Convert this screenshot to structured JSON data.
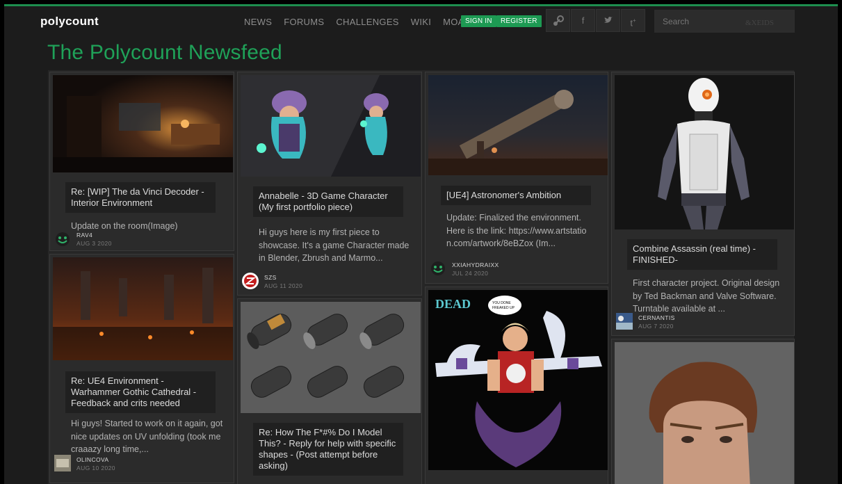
{
  "header": {
    "logo": "polycount",
    "nav": [
      "NEWS",
      "FORUMS",
      "CHALLENGES",
      "WIKI",
      "MOAR"
    ],
    "sign_in": "SIGN IN",
    "register": "REGISTER",
    "social_icons": [
      "steam-icon",
      "facebook-icon",
      "twitter-icon",
      "tumblr-icon"
    ],
    "search_placeholder": "Search",
    "search_watermark": "&XEIDS",
    "accent_color": "#1d9a53"
  },
  "page_title": "The Polycount Newsfeed",
  "posts": [
    {
      "title": "Re: [WIP] The da Vinci Decoder - Interior Environment",
      "excerpt": "Update on the room(Image)",
      "author": "RAV4",
      "date": "AUG 3 2020"
    },
    {
      "title": "Re: UE4 Environment - Warhammer Gothic Cathedral - Feedback and crits needed",
      "excerpt": "Hi guys! Started to work on it again, got nice updates on UV unfolding (took me craaazy long time,...",
      "author": "OLINCOVA",
      "date": "AUG 10 2020"
    },
    {
      "title": "Annabelle - 3D Game Character (My first portfolio piece)",
      "excerpt": "Hi guys here is my first piece to showcase. It's a game Character made in Blender, Zbrush and Marmo...",
      "author": "SZS",
      "date": "AUG 11 2020"
    },
    {
      "title": "Re: How The F*#% Do I Model This? - Reply for help with specific shapes - (Post attempt before asking)",
      "excerpt": "",
      "author": "",
      "date": ""
    },
    {
      "title": "[UE4] Astronomer's Ambition",
      "excerpt": "Update: Finalized the environment. Here is the link: https://www.artstation.com/artwork/8eBZox (Im...",
      "author": "XXIAHYDRAIXX",
      "date": "JUL 24 2020"
    },
    {
      "title": "Combine Assassin (real time) - FINISHED-",
      "excerpt": "First character project. Original design by Ted Backman and Valve Software. Turntable available at ...",
      "author": "CERNANTIS",
      "date": "AUG 7 2020"
    }
  ],
  "comic_speech": "YOU DONE FREAKED UP NOW!",
  "comic_logo": "DEAD"
}
